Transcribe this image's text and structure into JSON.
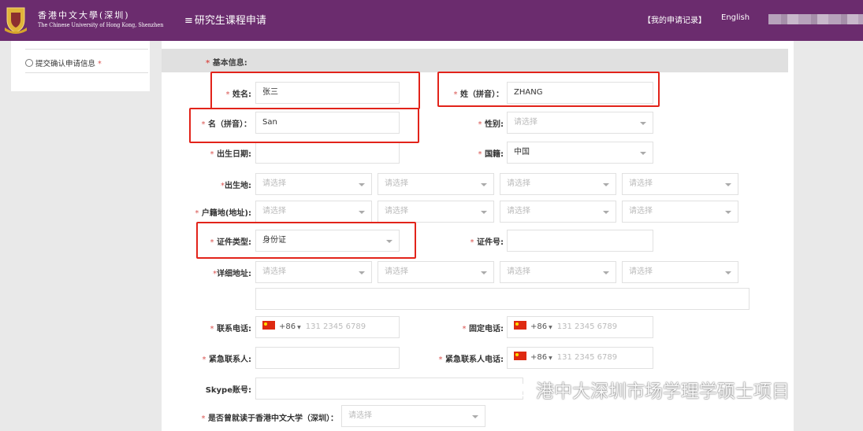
{
  "header": {
    "university_cn": "香港中文大學(深圳)",
    "university_en": "The Chinese University of Hong Kong, Shenzhen",
    "menu_icon": "≡",
    "title": "研究生课程申请",
    "my_records": "【我的申请记录】",
    "language": "English",
    "bg_color": "#6b2c6e"
  },
  "sidebar": {
    "item_label": "提交确认申请信息",
    "required": "*"
  },
  "form": {
    "section": "基本信息:",
    "required_mark": "*",
    "placeholder_select": "请选择",
    "fields": {
      "name": {
        "label": "姓名:",
        "value": "张三"
      },
      "surname_pinyin": {
        "label": "姓（拼音）：",
        "value": "ZHANG"
      },
      "given_pinyin": {
        "label": "名（拼音）：",
        "value": "San"
      },
      "gender": {
        "label": "性别:"
      },
      "birthdate": {
        "label": "出生日期:",
        "value": ""
      },
      "nationality": {
        "label": "国籍:",
        "value": "中国"
      },
      "birthplace": {
        "label": "出生地:"
      },
      "hukou": {
        "label": "户籍地(地址):"
      },
      "id_type": {
        "label": "证件类型:",
        "value": "身份证"
      },
      "id_number": {
        "label": "证件号:",
        "value": ""
      },
      "address": {
        "label": "详细地址:"
      },
      "mobile": {
        "label": "联系电话:",
        "code": "+86",
        "placeholder": "131 2345 6789"
      },
      "landline": {
        "label": "固定电话:",
        "code": "+86",
        "placeholder": "131 2345 6789"
      },
      "emergency_contact": {
        "label": "紧急联系人:",
        "value": ""
      },
      "emergency_phone": {
        "label": "紧急联系人电话:",
        "code": "+86",
        "placeholder": "131 2345 6789"
      },
      "skype": {
        "label": "Skype账号:",
        "value": ""
      },
      "studied_cuhk": {
        "label": "是否曾就读于香港中文大学（深圳）："
      }
    }
  },
  "watermark": "港中大深圳市场学理学硕士项目",
  "watermark_icon": "wechat-icon"
}
